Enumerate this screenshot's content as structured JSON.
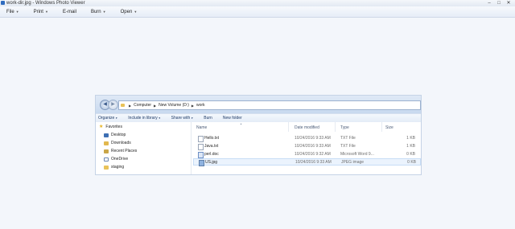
{
  "window": {
    "title": "work-dir.jpg - Windows Photo Viewer"
  },
  "menu": {
    "items": [
      {
        "label": "File"
      },
      {
        "label": "Print"
      },
      {
        "label": "E-mail"
      },
      {
        "label": "Burn"
      },
      {
        "label": "Open"
      }
    ]
  },
  "explorer": {
    "breadcrumb": [
      "Computer",
      "New Volume (D:)",
      "work"
    ],
    "toolbar": [
      "Organize",
      "Include in library",
      "Share with",
      "Burn",
      "New folder"
    ],
    "nav": {
      "favorites_label": "Favorites",
      "items": [
        "Desktop",
        "Downloads",
        "Recent Places",
        "OneDrive",
        "staging"
      ]
    },
    "columns": {
      "name": "Name",
      "date": "Date modified",
      "type": "Type",
      "size": "Size"
    },
    "files": [
      {
        "name": "Hello.txt",
        "date": "10/24/2016 9:33 AM",
        "type": "TXT File",
        "size": "1 KB"
      },
      {
        "name": "Java.txt",
        "date": "10/24/2016 9:33 AM",
        "type": "TXT File",
        "size": "1 KB"
      },
      {
        "name": "perl.doc",
        "date": "10/24/2016 9:32 AM",
        "type": "Microsoft Word 9...",
        "size": "0 KB"
      },
      {
        "name": "US.jpg",
        "date": "10/24/2016 9:33 AM",
        "type": "JPEG image",
        "size": "0 KB"
      }
    ]
  },
  "colors": {
    "accent": "#2f6cbf",
    "folder": "#e8c25a",
    "selection": "#ebf3fd"
  }
}
